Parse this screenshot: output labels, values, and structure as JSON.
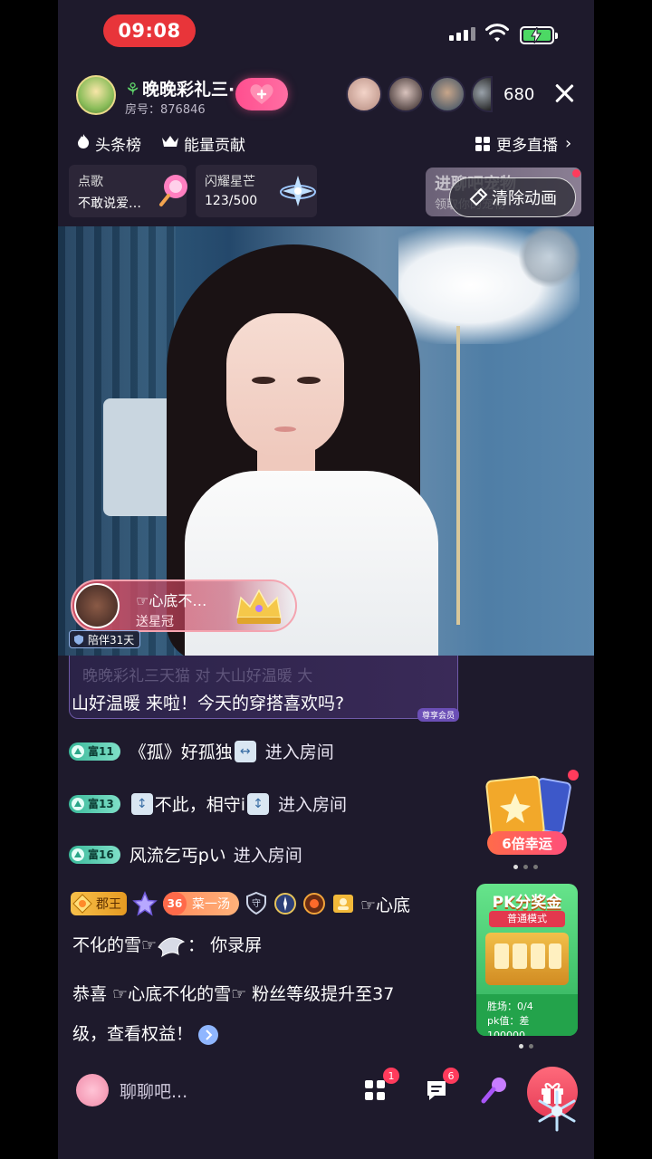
{
  "status": {
    "time": "09:08"
  },
  "host": {
    "name": "晚晚彩礼三·",
    "room_label": "房号：876846",
    "viewer_count": "680"
  },
  "ranks": {
    "headline": "头条榜",
    "energy": "能量贡献",
    "more_live": "更多直播"
  },
  "cards": {
    "song": {
      "title": "点歌",
      "value": "不敢说爱…"
    },
    "star": {
      "title": "闪耀星芒",
      "value": "123/500"
    }
  },
  "promo": {
    "title": "进聊吧宠物",
    "subtitle": "领取你的宠物",
    "clear_label": "清除动画"
  },
  "gift_banner": {
    "user": "☞心底不…",
    "action": "送星冠",
    "companion": "陪伴31天"
  },
  "chat": {
    "pinned_faded": "晚晚彩礼三天猫 对 大山好温暖 大",
    "pinned_text": "山好温暖 来啦！今天的穿搭喜欢吗?",
    "pinned_tag": "尊享会员",
    "entries": [
      {
        "level": "富11",
        "name": "《孤》好孤独",
        "suffix": "进入房间"
      },
      {
        "level": "富13",
        "name": "不此，相守i",
        "suffix": "进入房间"
      },
      {
        "level": "富16",
        "name": "风流乞丐pい",
        "suffix": "进入房间"
      }
    ],
    "badges": {
      "noble": "郡王",
      "fan_level": "36",
      "fan_club": "菜一汤",
      "guard": "守",
      "sender": "☞心底"
    },
    "message_line1": "不化的雪☞",
    "message_colon": "：",
    "message_body": "你录屏",
    "system_line1": "恭喜 ☞心底不化的雪☞ 粉丝等级提升至37",
    "system_line2": "级，查看权益！"
  },
  "lucky": {
    "label": "6倍幸运"
  },
  "pk": {
    "title": "PK分奖金",
    "mode": "普通模式",
    "wins": "胜场：0/4",
    "pk_value": "pk值：差100000"
  },
  "bottom": {
    "chat_placeholder": "聊聊吧...",
    "apps_badge": "1",
    "msg_badge": "6"
  },
  "colors": {
    "accent_pink": "#ff4f8f",
    "background": "#1e1a2c",
    "level_badge": "#3ab99a",
    "pk_green": "#2eae5a"
  }
}
